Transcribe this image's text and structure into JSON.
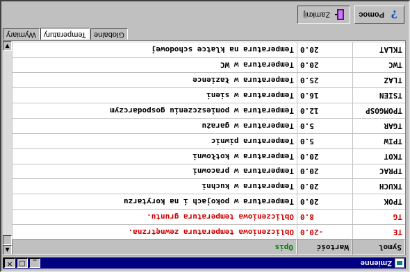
{
  "window": {
    "title": "Zmienne"
  },
  "titlebar_buttons": [
    "_",
    "□",
    "✕"
  ],
  "grid": {
    "columns": [
      "Symol",
      "Wartość",
      "Opis"
    ],
    "rows": [
      {
        "symbol": "TE",
        "value": "-20.0",
        "desc": "Obliczeniowa temperatura zewnętrzna.",
        "color": "#cc0000"
      },
      {
        "symbol": "TG",
        "value": "8.0",
        "desc": "Obliczeniowa temperatura gruntu.",
        "color": "#cc0000"
      },
      {
        "symbol": "TPOK",
        "value": "20.0",
        "desc": "Temperatura w pokojach i na korytarzu",
        "color": "#000000"
      },
      {
        "symbol": "TKUCH",
        "value": "20.0",
        "desc": "Temperatura w kuchni",
        "color": "#000000"
      },
      {
        "symbol": "TPRAC",
        "value": "20.0",
        "desc": "Temperatura w pracowni",
        "color": "#000000"
      },
      {
        "symbol": "TKOT",
        "value": "20.0",
        "desc": "Temperatura w kotłowni",
        "color": "#000000"
      },
      {
        "symbol": "TPIW",
        "value": "5.0",
        "desc": "Temperatura piwnic",
        "color": "#000000"
      },
      {
        "symbol": "TGAR",
        "value": "5.0",
        "desc": "Temperatura w garażu",
        "color": "#000000"
      },
      {
        "symbol": "TPOMGOSP",
        "value": "12.0",
        "desc": "Temperatura w pomieszczeniu gospodarczym",
        "color": "#000000"
      },
      {
        "symbol": "TSIEN",
        "value": "16.0",
        "desc": "Temperatura w sieni",
        "color": "#000000"
      },
      {
        "symbol": "TLAZ",
        "value": "25.0",
        "desc": "Temperatura w łazience",
        "color": "#000000"
      },
      {
        "symbol": "TWC",
        "value": "20.0",
        "desc": "Temperatura w WC",
        "color": "#000000"
      },
      {
        "symbol": "TKLAT",
        "value": "20.0",
        "desc": "Temperatura na klatce schodowej",
        "color": "#000000"
      }
    ],
    "header_colors": {
      "symbol": "#000000",
      "value": "#000000",
      "desc": "#008000"
    }
  },
  "tabs": [
    "Globalne",
    "Temperatury",
    "Wymiary"
  ],
  "active_tab": "Temperatury",
  "toolbar": {
    "help_label": "Pomoc",
    "close_label": "Zamknij"
  },
  "colors": {
    "titlebar": "#000080",
    "face": "#c0c0c0",
    "red_text": "#cc0000",
    "green_text": "#008000"
  }
}
